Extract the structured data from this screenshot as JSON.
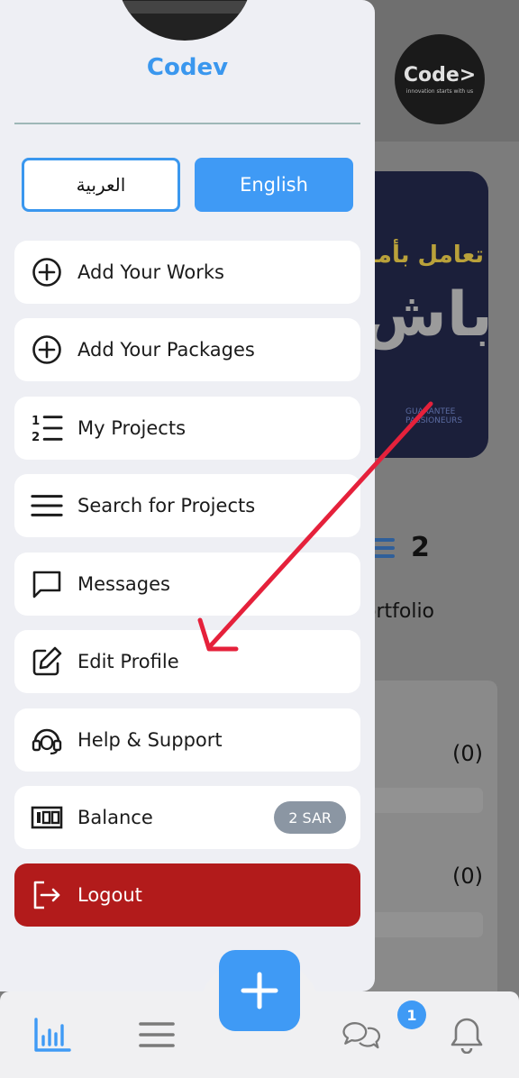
{
  "background": {
    "logo_main": "Code>",
    "logo_sub": "innovation starts with us",
    "banner_line1": "تعامل بأمـ",
    "banner_line2": "باش",
    "banner_small": "GUARANTEE\nPASSIONEURS",
    "count": "2",
    "portfolio_text": "ortfolio",
    "zero1": "(0)",
    "zero2": "(0)"
  },
  "drawer": {
    "brand": "Codev",
    "lang_arabic": "العربية",
    "lang_english": "English",
    "items": [
      {
        "label": "Add Your Works",
        "icon": "plus-circle-icon"
      },
      {
        "label": "Add Your Packages",
        "icon": "plus-circle-icon"
      },
      {
        "label": "My Projects",
        "icon": "numbered-list-icon"
      },
      {
        "label": "Search for Projects",
        "icon": "menu-lines-icon"
      },
      {
        "label": "Messages",
        "icon": "message-icon"
      },
      {
        "label": "Edit Profile",
        "icon": "edit-icon"
      },
      {
        "label": "Help & Support",
        "icon": "headset-icon"
      },
      {
        "label": "Balance",
        "icon": "balance-icon",
        "badge": "2 SAR"
      },
      {
        "label": "Logout",
        "icon": "logout-icon"
      }
    ]
  },
  "bottom_nav": {
    "chat_badge": "1"
  },
  "colors": {
    "accent": "#3f9af5",
    "logout": "#b21b1b",
    "annotation_arrow": "#e5213b"
  }
}
